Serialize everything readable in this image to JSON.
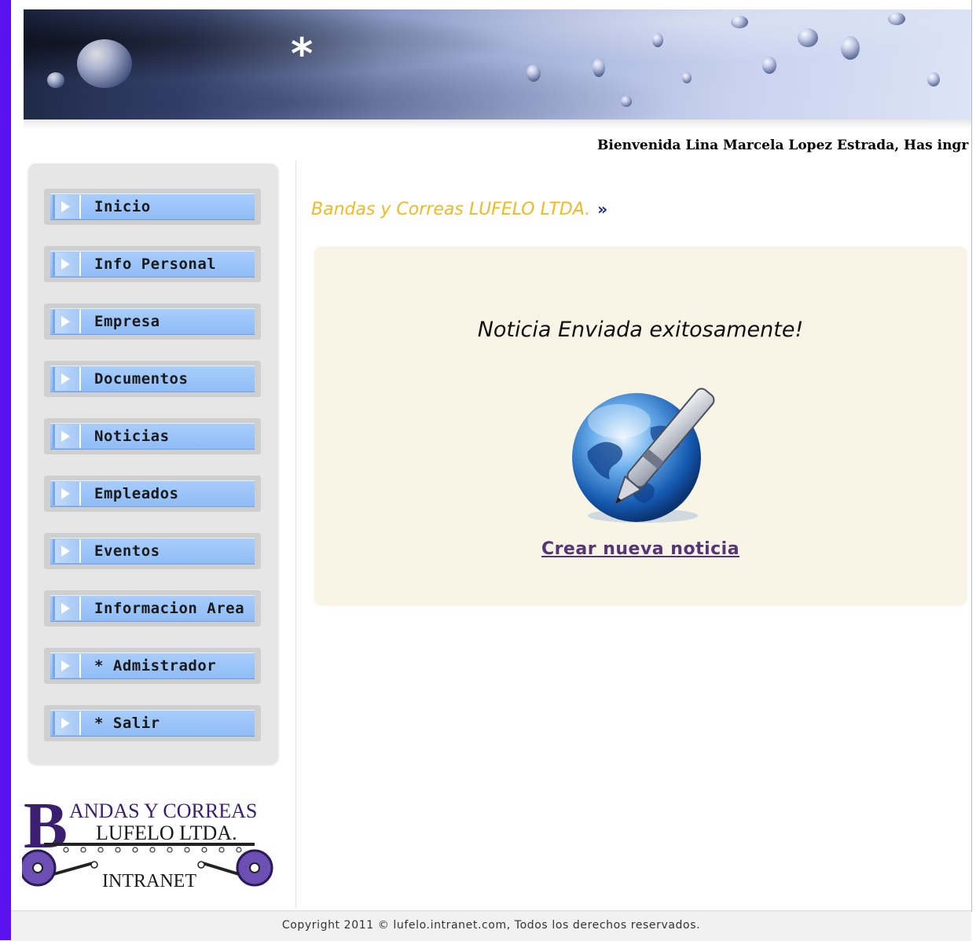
{
  "header": {
    "welcome_text": "Bienvenida Lina Marcela Lopez Estrada, Has ingr"
  },
  "sidebar": {
    "items": [
      {
        "label": "Inicio",
        "icon": "play-arrow-icon"
      },
      {
        "label": "Info Personal",
        "icon": "play-arrow-icon"
      },
      {
        "label": "Empresa",
        "icon": "play-arrow-icon"
      },
      {
        "label": "Documentos",
        "icon": "play-arrow-icon"
      },
      {
        "label": "Noticias",
        "icon": "play-arrow-icon"
      },
      {
        "label": "Empleados",
        "icon": "play-arrow-icon"
      },
      {
        "label": "Eventos",
        "icon": "play-arrow-icon"
      },
      {
        "label": "Informacion Area",
        "icon": "play-arrow-icon"
      },
      {
        "label": "* Admistrador",
        "icon": "play-arrow-icon"
      },
      {
        "label": "* Salir",
        "icon": "play-arrow-icon"
      }
    ]
  },
  "logo": {
    "initial": "B",
    "line1": "ANDAS Y CORREAS",
    "line2": "LUFELO LTDA.",
    "line3": "INTRANET"
  },
  "main": {
    "company_title": "Bandas y Correas LUFELO LTDA.",
    "title_chevron": "»",
    "message": "Noticia Enviada exitosamente!",
    "icon": "globe-pen-icon",
    "link_label": "Crear nueva noticia"
  },
  "footer": {
    "copyright": "Copyright 2011 © lufelo.intranet.com, Todos los derechos reservados."
  },
  "colors": {
    "left_bar": "#5a12f0",
    "title_text": "#efba22",
    "panel_bg": "#f8f4e6",
    "nav_button": "#8fbcf6",
    "link": "#56347a"
  }
}
